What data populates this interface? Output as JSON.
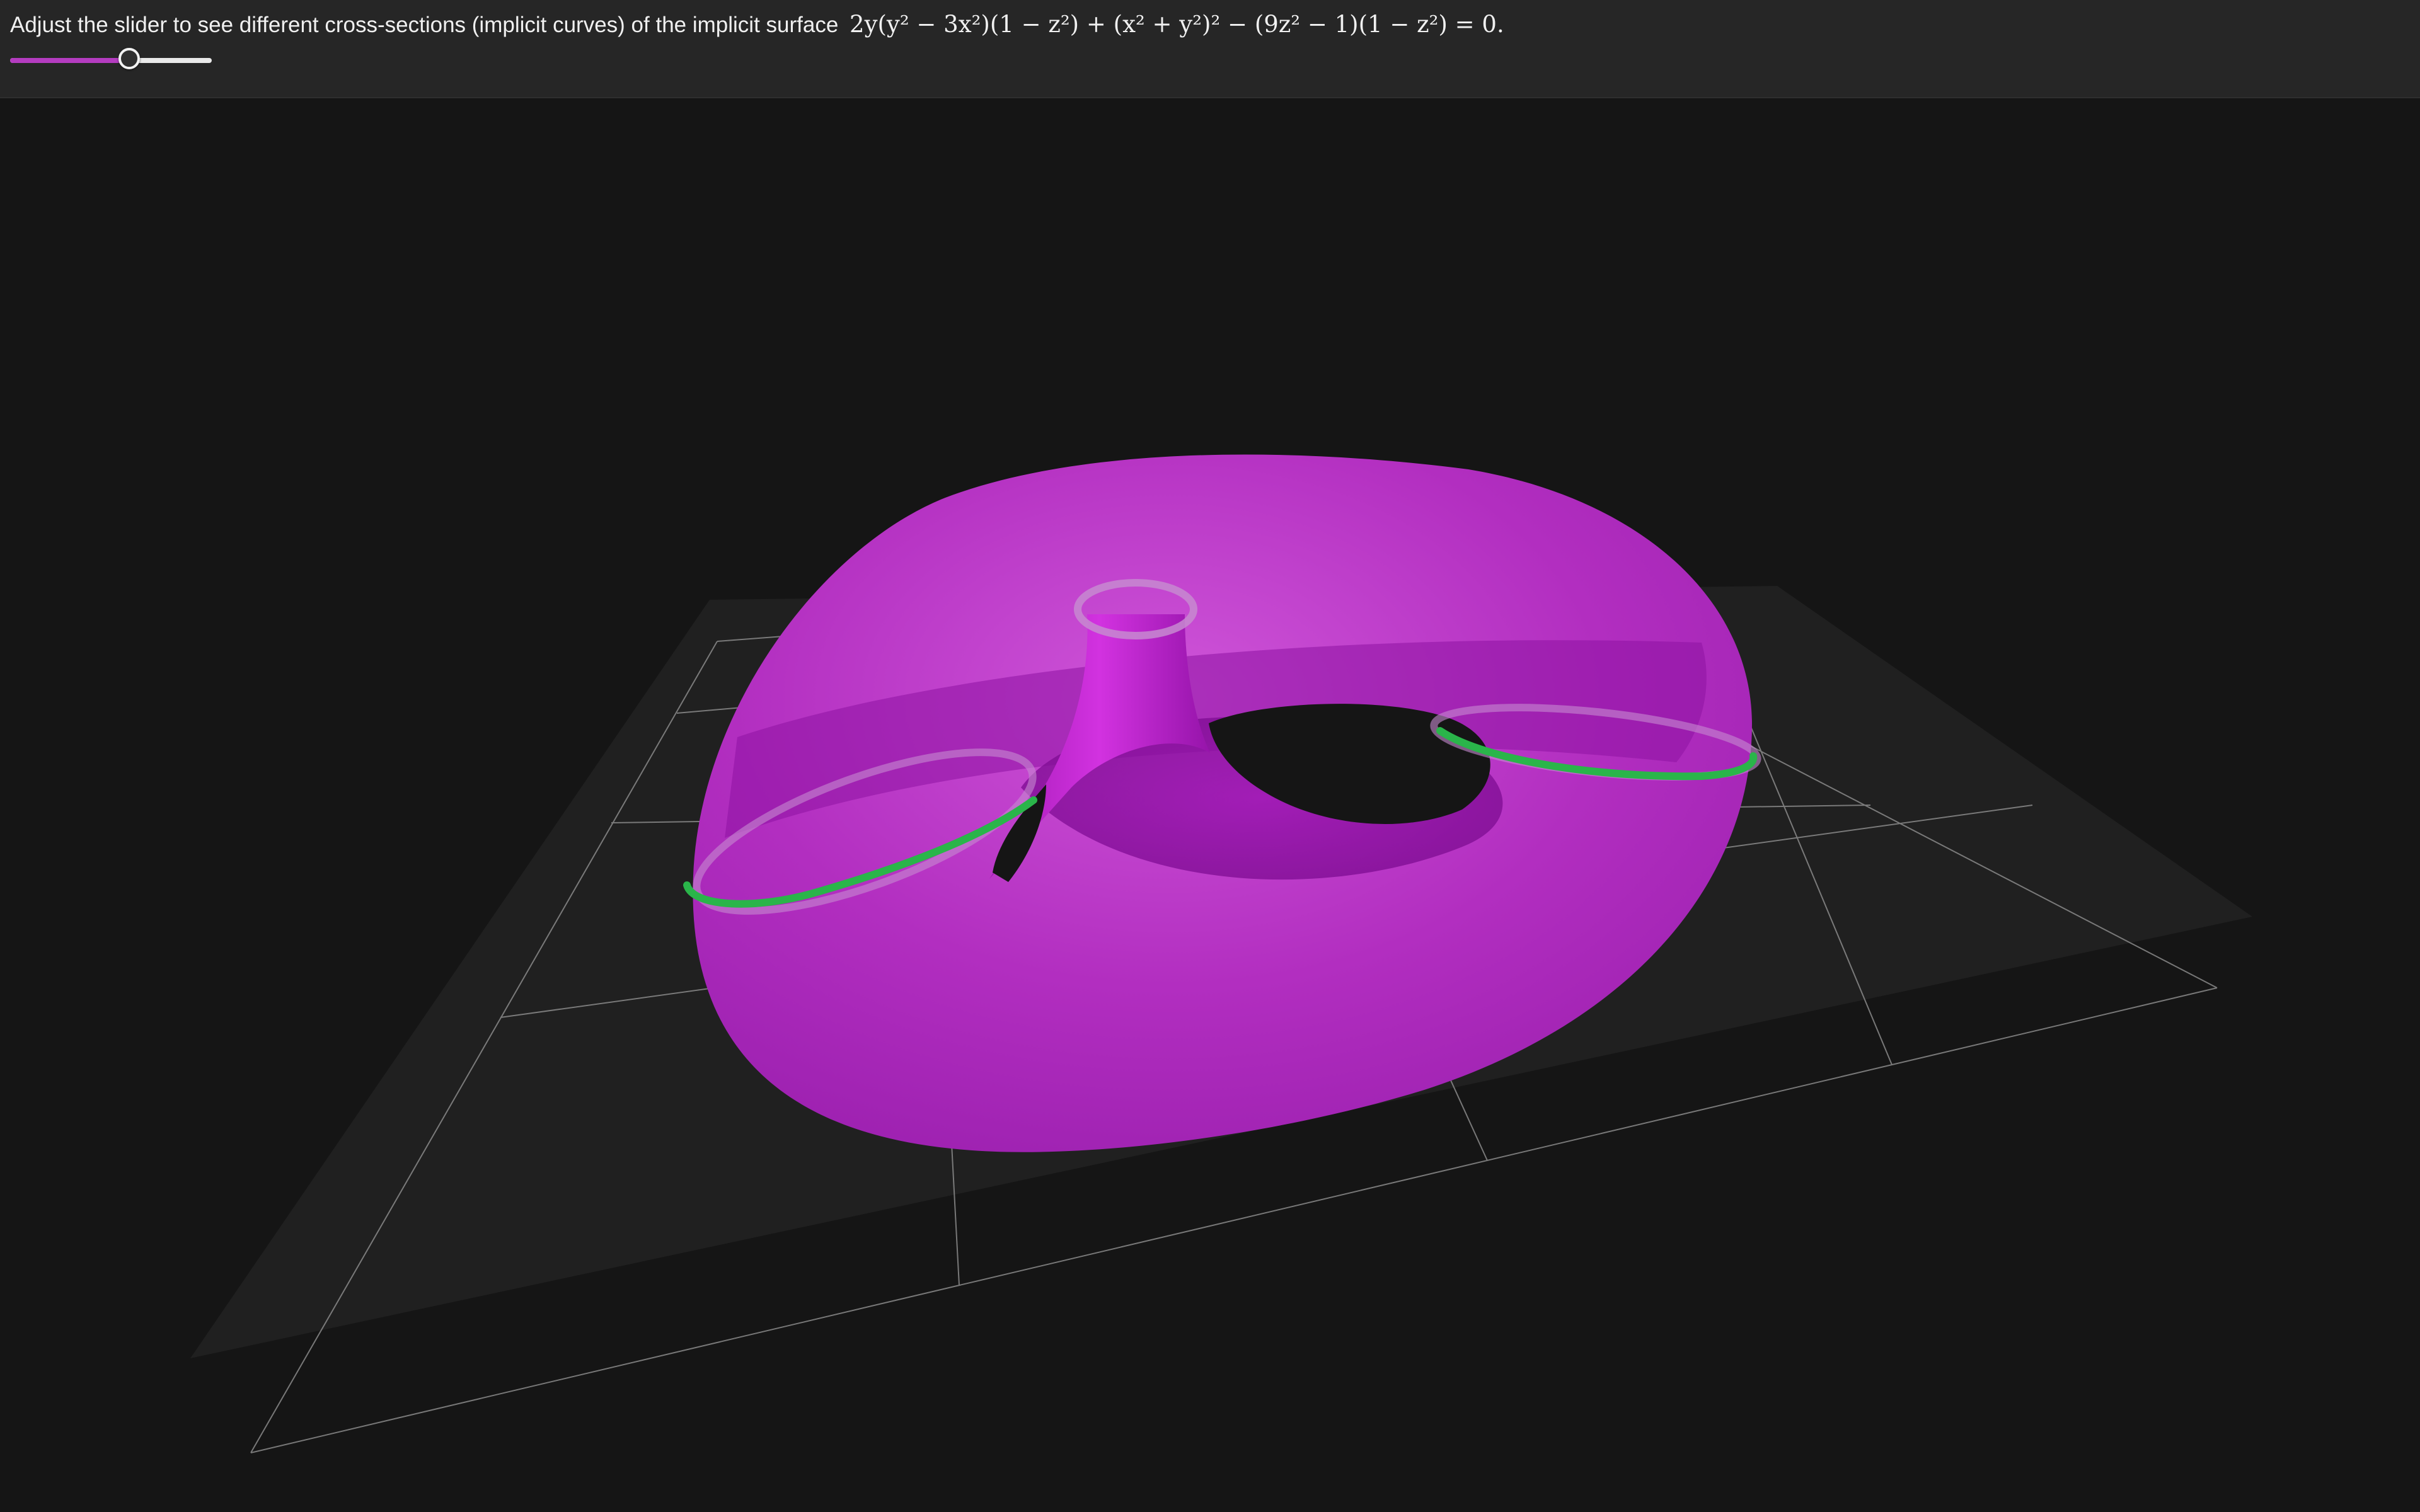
{
  "instruction": {
    "prefix": "Adjust the slider to see different cross-sections (implicit curves) of the implicit surface",
    "equation": "2y(y² − 3x²)(1 − z²) + (x² + y²)² − (9z² − 1)(1 − z²) = 0."
  },
  "slider": {
    "fraction": 0.59
  },
  "colors": {
    "surface": "#b22ec0",
    "surface_dark": "#8f15a0",
    "surface_light": "#cd4fd8",
    "slice_curve": "#2ab54a",
    "slice_highlight": "#c78ad0",
    "ground_plane": "#202020",
    "grid_lines": "#8a8a8a",
    "background": "#151515",
    "toolbar": "#262626",
    "slider_fill": "#b43cc0"
  },
  "icons": {
    "slider_thumb": "circle-handle"
  }
}
